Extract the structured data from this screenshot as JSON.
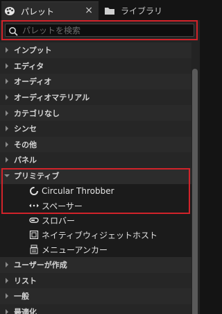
{
  "tabs": [
    {
      "label": "パレット",
      "icon": "palette-icon",
      "close": "×"
    },
    {
      "label": "ライブラリ",
      "icon": "folder-icon"
    }
  ],
  "search": {
    "placeholder": "パレットを検索"
  },
  "categories_top": [
    {
      "label": "インプット"
    },
    {
      "label": "エディタ"
    },
    {
      "label": "オーディオ"
    },
    {
      "label": "オーディオマテリアル"
    },
    {
      "label": "カテゴリなし"
    },
    {
      "label": "シンセ"
    },
    {
      "label": "その他"
    },
    {
      "label": "パネル"
    }
  ],
  "primitive": {
    "label": "プリミティブ",
    "items": [
      {
        "label": "Circular Throbber",
        "icon": "throbber-icon"
      },
      {
        "label": "スペーサー",
        "icon": "spacer-icon"
      },
      {
        "label": "スロバー",
        "icon": "throbber-bar-icon"
      },
      {
        "label": "ネイティブウィジェットホスト",
        "icon": "widget-host-icon"
      },
      {
        "label": "メニューアンカー",
        "icon": "menu-anchor-icon"
      }
    ]
  },
  "categories_bottom": [
    {
      "label": "ユーザーが作成"
    },
    {
      "label": "リスト"
    },
    {
      "label": "一般"
    },
    {
      "label": "最適化"
    }
  ],
  "colors": {
    "highlight": "#d2232a",
    "panel": "#232323"
  }
}
